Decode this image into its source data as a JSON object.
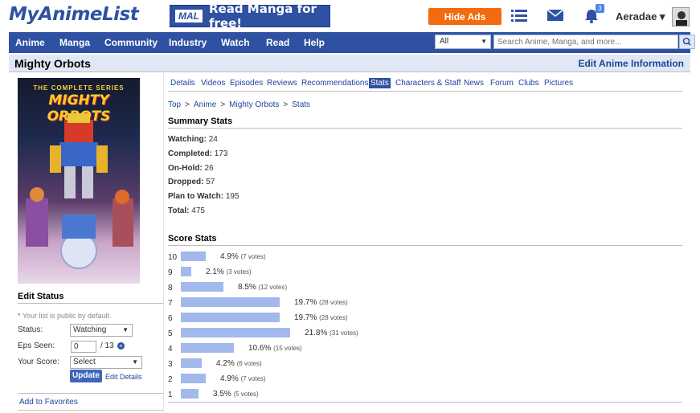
{
  "header": {
    "logo": "MyAnimeList",
    "banner_tag": "MAL",
    "banner_text": "Read Manga for free!",
    "hide_ads": "Hide Ads",
    "notification_count": "3",
    "username": "Aeradae ▾"
  },
  "nav": {
    "items": [
      "Anime",
      "Manga",
      "Community",
      "Industry",
      "Watch",
      "Read",
      "Help"
    ],
    "search_scope": "All",
    "search_placeholder": "Search Anime, Manga, and more..."
  },
  "title": {
    "name": "Mighty Orbots",
    "edit_link": "Edit Anime Information"
  },
  "cover": {
    "series_text": "THE COMPLETE SERIES",
    "cover_title": "MIGHTY ORBOTS"
  },
  "sidebar": {
    "edit_status_heading": "Edit Status",
    "public_note": "Your list is public by default.",
    "status_label": "Status:",
    "status_value": "Watching",
    "eps_label": "Eps Seen:",
    "eps_value": "0",
    "eps_total": "/ 13",
    "score_label": "Your Score:",
    "score_value": "Select",
    "update_button": "Update",
    "edit_details": "Edit Details",
    "add_favorites": "Add to Favorites"
  },
  "tabs": [
    "Details",
    "Videos",
    "Episodes",
    "Reviews",
    "Recommendations",
    "Stats",
    "Characters & Staff",
    "News",
    "Forum",
    "Clubs",
    "Pictures"
  ],
  "active_tab": "Stats",
  "breadcrumb": [
    "Top",
    "Anime",
    "Mighty Orbots",
    "Stats"
  ],
  "summary": {
    "heading": "Summary Stats",
    "rows": [
      {
        "label": "Watching:",
        "value": "24"
      },
      {
        "label": "Completed:",
        "value": "173"
      },
      {
        "label": "On-Hold:",
        "value": "26"
      },
      {
        "label": "Dropped:",
        "value": "57"
      },
      {
        "label": "Plan to Watch:",
        "value": "195"
      },
      {
        "label": "Total:",
        "value": "475"
      }
    ]
  },
  "score_stats": {
    "heading": "Score Stats",
    "rows": [
      {
        "score": "10",
        "pct": "4.9%",
        "votes": "(7 votes)",
        "value": 4.9
      },
      {
        "score": "9",
        "pct": "2.1%",
        "votes": "(3 votes)",
        "value": 2.1
      },
      {
        "score": "8",
        "pct": "8.5%",
        "votes": "(12 votes)",
        "value": 8.5
      },
      {
        "score": "7",
        "pct": "19.7%",
        "votes": "(28 votes)",
        "value": 19.7
      },
      {
        "score": "6",
        "pct": "19.7%",
        "votes": "(28 votes)",
        "value": 19.7
      },
      {
        "score": "5",
        "pct": "21.8%",
        "votes": "(31 votes)",
        "value": 21.8
      },
      {
        "score": "4",
        "pct": "10.6%",
        "votes": "(15 votes)",
        "value": 10.6
      },
      {
        "score": "3",
        "pct": "4.2%",
        "votes": "(6 votes)",
        "value": 4.2
      },
      {
        "score": "2",
        "pct": "4.9%",
        "votes": "(7 votes)",
        "value": 4.9
      },
      {
        "score": "1",
        "pct": "3.5%",
        "votes": "(5 votes)",
        "value": 3.5
      }
    ]
  },
  "colors": {
    "brand": "#2e51a2",
    "accent": "#f26b0f",
    "bar": "#a3b8ec"
  }
}
